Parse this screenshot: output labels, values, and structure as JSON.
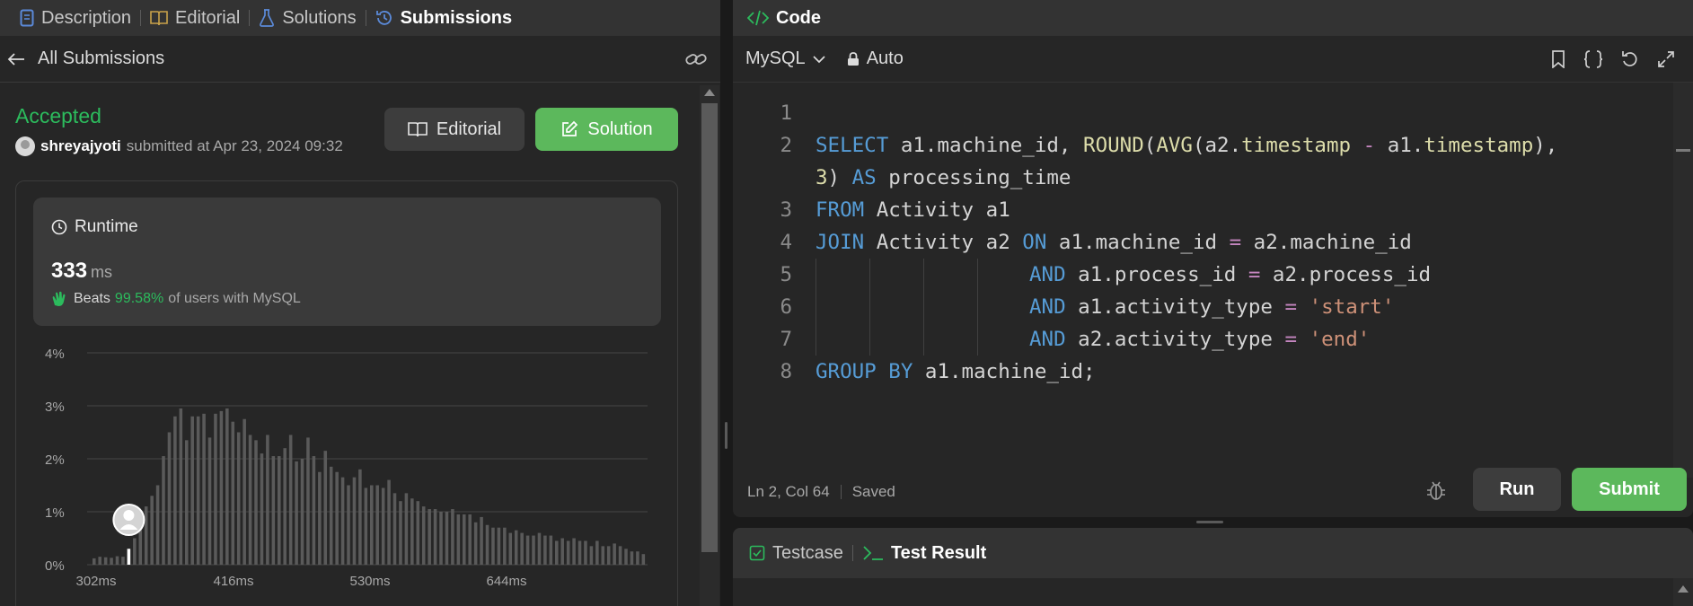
{
  "left_tabs": [
    {
      "label": "Description"
    },
    {
      "label": "Editorial"
    },
    {
      "label": "Solutions"
    },
    {
      "label": "Submissions"
    }
  ],
  "subbar": {
    "back_label": "All Submissions"
  },
  "submission": {
    "status": "Accepted",
    "username": "shreyajyoti",
    "submitted_text": "submitted at Apr 23, 2024 09:32"
  },
  "buttons": {
    "editorial": "Editorial",
    "solution": "Solution"
  },
  "runtime": {
    "title": "Runtime",
    "value": "333",
    "unit": "ms",
    "beats_label": "Beats",
    "beats_pct": "99.58%",
    "beats_rest": "of users with MySQL"
  },
  "chart_data": {
    "type": "bar",
    "title": "",
    "xlabel": "",
    "ylabel": "",
    "ylim": [
      0,
      4
    ],
    "y_ticks": [
      "0%",
      "1%",
      "2%",
      "3%",
      "4%"
    ],
    "x_ticks": [
      "302ms",
      "416ms",
      "530ms",
      "644ms"
    ],
    "values": [
      0.12,
      0.15,
      0.14,
      0.13,
      0.16,
      0.15,
      0.3,
      0.5,
      0.8,
      1.1,
      1.3,
      1.5,
      2.05,
      2.5,
      2.8,
      2.95,
      2.35,
      2.8,
      2.8,
      2.85,
      2.4,
      2.85,
      2.9,
      2.95,
      2.7,
      2.5,
      2.75,
      2.45,
      2.35,
      2.1,
      2.45,
      2.05,
      2.05,
      2.2,
      2.45,
      1.95,
      2.0,
      2.4,
      2.05,
      1.75,
      2.15,
      1.85,
      1.75,
      1.65,
      1.5,
      1.65,
      1.8,
      1.45,
      1.5,
      1.5,
      1.45,
      1.6,
      1.35,
      1.2,
      1.35,
      1.25,
      1.2,
      1.1,
      1.05,
      1.05,
      1.0,
      1.0,
      1.05,
      0.95,
      0.95,
      0.95,
      0.8,
      0.9,
      0.75,
      0.7,
      0.7,
      0.7,
      0.6,
      0.65,
      0.6,
      0.55,
      0.55,
      0.6,
      0.55,
      0.55,
      0.45,
      0.5,
      0.45,
      0.5,
      0.45,
      0.45,
      0.35,
      0.45,
      0.35,
      0.35,
      0.4,
      0.35,
      0.3,
      0.25,
      0.25,
      0.2
    ],
    "highlight_index": 6,
    "bar_color": "#5a5a5a",
    "highlight_color": "#ffffff",
    "grid": true
  },
  "editor": {
    "title": "Code",
    "language": "MySQL",
    "mode": "Auto",
    "lines": [
      "1",
      "2",
      "",
      "3",
      "4",
      "5",
      "6",
      "7",
      "8"
    ],
    "status_pos": "Ln 2, Col 64",
    "status_saved": "Saved",
    "run_label": "Run",
    "submit_label": "Submit"
  },
  "code_tokens": {
    "l2a": "SELECT",
    "l2b": " a1.machine_id, ",
    "l2c": "ROUND",
    "l2d": "(",
    "l2e": "AVG",
    "l2f": "(a2.",
    "l2g": "timestamp",
    "l2h": " - ",
    "l2i": "a1.",
    "l2j": "timestamp",
    "l2k": "),",
    "l2wrap_a": "3",
    "l2wrap_b": ") ",
    "l2wrap_c": "AS",
    "l2wrap_d": " processing_time",
    "l3a": "FROM",
    "l3b": " Activity a1",
    "l4a": "JOIN",
    "l4b": " Activity a2 ",
    "l4c": "ON",
    "l4d": " a1.machine_id ",
    "l4e": "=",
    "l4f": " a2.machine_id",
    "l5a": "AND",
    "l5b": " a1.process_id ",
    "l5c": "=",
    "l5d": " a2.process_id",
    "l6a": "AND",
    "l6b": " a1.activity_type ",
    "l6c": "=",
    "l6d": " 'start'",
    "l7a": "AND",
    "l7b": " a2.activity_type ",
    "l7c": "=",
    "l7d": " 'end'",
    "l8a": "GROUP BY",
    "l8b": " a1.machine_id;"
  },
  "test_tabs": [
    {
      "label": "Testcase"
    },
    {
      "label": "Test Result"
    }
  ],
  "colors": {
    "accent_green": "#2cbb5d",
    "button_green": "#5cb85c",
    "bg_panel": "#262626",
    "bg_header": "#333333"
  }
}
